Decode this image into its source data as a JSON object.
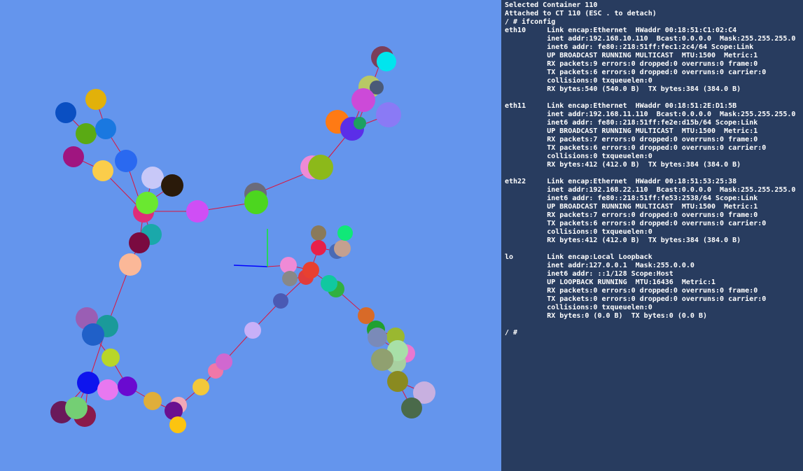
{
  "colors": {
    "viewport_bg": "#6495ed",
    "console_bg": "#283c5f",
    "console_fg": "#ffffff",
    "edge": "#dc143c",
    "axis_x": "#0000ff",
    "axis_y": "#00ff00"
  },
  "console": {
    "lines": [
      "Selected Container 110",
      "Attached to CT 110 (ESC . to detach)",
      "/ # ifconfig",
      "eth10     Link encap:Ethernet  HWaddr 00:18:51:C1:02:C4",
      "          inet addr:192.168.10.110  Bcast:0.0.0.0  Mask:255.255.255.0",
      "          inet6 addr: fe80::218:51ff:fec1:2c4/64 Scope:Link",
      "          UP BROADCAST RUNNING MULTICAST  MTU:1500  Metric:1",
      "          RX packets:9 errors:0 dropped:0 overruns:0 frame:0",
      "          TX packets:6 errors:0 dropped:0 overruns:0 carrier:0",
      "          collisions:0 txqueuelen:0",
      "          RX bytes:540 (540.0 B)  TX bytes:384 (384.0 B)",
      "",
      "eth11     Link encap:Ethernet  HWaddr 00:18:51:2E:D1:5B",
      "          inet addr:192.168.11.110  Bcast:0.0.0.0  Mask:255.255.255.0",
      "          inet6 addr: fe80::218:51ff:fe2e:d15b/64 Scope:Link",
      "          UP BROADCAST RUNNING MULTICAST  MTU:1500  Metric:1",
      "          RX packets:7 errors:0 dropped:0 overruns:0 frame:0",
      "          TX packets:6 errors:0 dropped:0 overruns:0 carrier:0",
      "          collisions:0 txqueuelen:0",
      "          RX bytes:412 (412.0 B)  TX bytes:384 (384.0 B)",
      "",
      "eth22     Link encap:Ethernet  HWaddr 00:18:51:53:25:38",
      "          inet addr:192.168.22.110  Bcast:0.0.0.0  Mask:255.255.255.0",
      "          inet6 addr: fe80::218:51ff:fe53:2538/64 Scope:Link",
      "          UP BROADCAST RUNNING MULTICAST  MTU:1500  Metric:1",
      "          RX packets:7 errors:0 dropped:0 overruns:0 frame:0",
      "          TX packets:6 errors:0 dropped:0 overruns:0 carrier:0",
      "          collisions:0 txqueuelen:0",
      "          RX bytes:412 (412.0 B)  TX bytes:384 (384.0 B)",
      "",
      "lo        Link encap:Local Loopback",
      "          inet addr:127.0.0.1  Mask:255.0.0.0",
      "          inet6 addr: ::1/128 Scope:Host",
      "          UP LOOPBACK RUNNING  MTU:16436  Metric:1",
      "          RX packets:0 errors:0 dropped:0 overruns:0 frame:0",
      "          TX packets:0 errors:0 dropped:0 overruns:0 carrier:0",
      "          collisions:0 txqueuelen:0",
      "          RX bytes:0 (0.0 B)  TX bytes:0 (0.0 B)",
      "",
      "/ #"
    ]
  }
}
